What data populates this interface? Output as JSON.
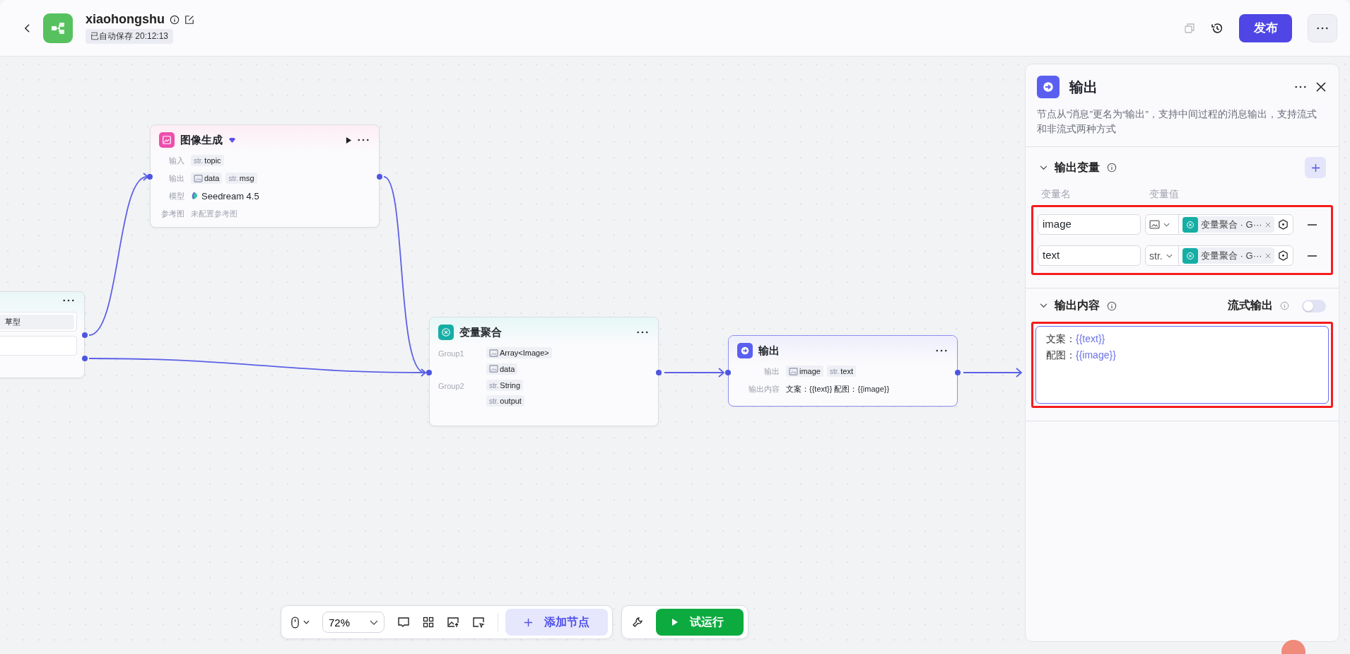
{
  "header": {
    "title": "xiaohongshu",
    "autosave": "已自动保存 20:12:13",
    "publish_button": "发布"
  },
  "canvas": {
    "partial_node": {
      "fields": [
        "草型"
      ]
    },
    "image_node": {
      "title": "图像生成",
      "premium": true,
      "rows": [
        {
          "label": "输入",
          "tags": [
            {
              "kind": "text",
              "prefix": "str.",
              "name": "topic"
            }
          ]
        },
        {
          "label": "输出",
          "tags": [
            {
              "kind": "image",
              "name": "data"
            },
            {
              "kind": "text",
              "prefix": "str.",
              "name": "msg"
            }
          ]
        },
        {
          "label": "模型",
          "model": "Seedream 4.5"
        },
        {
          "label": "参考图",
          "note": "未配置参考图"
        }
      ]
    },
    "aggregate_node": {
      "title": "变量聚合",
      "groups": [
        {
          "name": "Group1",
          "items": [
            {
              "kind": "image",
              "name": "Array<Image>"
            },
            {
              "kind": "image",
              "name": "data"
            }
          ]
        },
        {
          "name": "Group2",
          "items": [
            {
              "kind": "text",
              "prefix": "str.",
              "name": "String"
            },
            {
              "kind": "text",
              "prefix": "str.",
              "name": "output"
            }
          ]
        }
      ]
    },
    "output_node": {
      "title": "输出",
      "selected": true,
      "output_label": "输出",
      "outputs": [
        {
          "kind": "image",
          "name": "image"
        },
        {
          "kind": "text",
          "prefix": "str.",
          "name": "text"
        }
      ],
      "content_label": "输出内容",
      "content": "文案：{{text}} 配图：{{image}}"
    }
  },
  "panel": {
    "title": "输出",
    "description": "节点从“消息”更名为“输出”，支持中间过程的消息输出，支持流式和非流式两种方式",
    "variables_section": {
      "title": "输出变量",
      "expanded": true,
      "highlighted": true,
      "column_1": "变量名",
      "column_2": "变量值",
      "rows": [
        {
          "name": "image",
          "kind": "image",
          "source": "变量聚合 · G···"
        },
        {
          "name": "text",
          "kind": "text",
          "type_label": "str.",
          "source": "变量聚合 · G···"
        }
      ]
    },
    "content_section": {
      "title": "输出内容",
      "expanded": true,
      "highlighted": true,
      "streaming_label": "流式输出",
      "streaming": false,
      "lines": [
        {
          "label": "文案：",
          "variable": "{{text}}"
        },
        {
          "label": "配图：",
          "variable": "{{image}}"
        }
      ]
    }
  },
  "toolbar": {
    "zoom": "72%",
    "add_node": "添加节点",
    "run": "试运行"
  }
}
